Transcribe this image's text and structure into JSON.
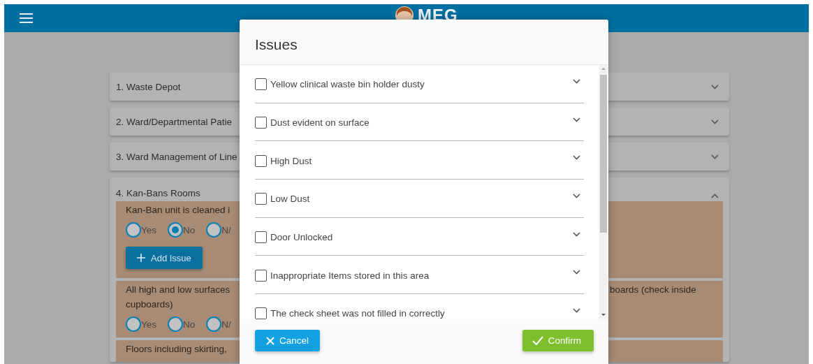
{
  "header": {
    "logo_text": "MEG"
  },
  "sections": [
    {
      "title": "1. Waste Depot",
      "expanded": false
    },
    {
      "title": "2. Ward/Departmental Patie",
      "expanded": false
    },
    {
      "title": "3. Ward Management of Line",
      "expanded": false
    },
    {
      "title": "4. Kan-Bans Rooms",
      "expanded": true,
      "questions": [
        {
          "text_left": [
            "Kan-Ban unit is cleaned i"
          ],
          "options": [
            {
              "label": "Yes",
              "selected": false
            },
            {
              "label": "No",
              "selected": true
            },
            {
              "label": "N/",
              "selected": false
            }
          ],
          "add_issue": "Add Issue"
        },
        {
          "text_left": [
            "All high and low surfaces",
            "cupboards)"
          ],
          "text_right": "boards (check inside",
          "options": [
            {
              "label": "Yes",
              "selected": false
            },
            {
              "label": "No",
              "selected": false
            },
            {
              "label": "N/",
              "selected": false
            }
          ]
        },
        {
          "text_left": [
            "Floors including skirting,"
          ]
        }
      ]
    }
  ],
  "dialog": {
    "title": "Issues",
    "items": [
      {
        "label": "Yellow clinical waste bin holder dusty",
        "checked": false
      },
      {
        "label": "Dust evident on surface",
        "checked": false
      },
      {
        "label": "High Dust",
        "checked": false
      },
      {
        "label": "Low Dust",
        "checked": false
      },
      {
        "label": "Door Unlocked",
        "checked": false
      },
      {
        "label": "Inappropriate Items stored in this area",
        "checked": false
      },
      {
        "label": "The check sheet was not filled in correctly",
        "checked": false
      }
    ],
    "cancel": "Cancel",
    "confirm": "Confirm"
  }
}
